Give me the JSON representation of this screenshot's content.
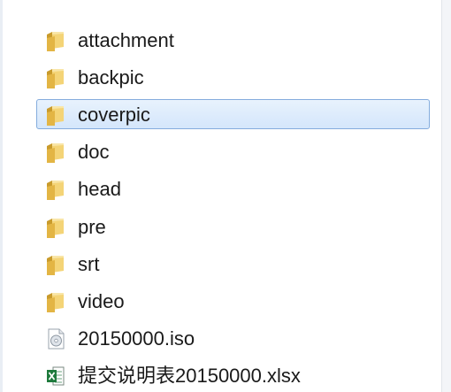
{
  "explorer": {
    "items": [
      {
        "name": "attachment",
        "type": "folder",
        "icon": "folder-icon",
        "selected": false
      },
      {
        "name": "backpic",
        "type": "folder",
        "icon": "folder-icon",
        "selected": false
      },
      {
        "name": "coverpic",
        "type": "folder",
        "icon": "folder-icon",
        "selected": true
      },
      {
        "name": "doc",
        "type": "folder",
        "icon": "folder-icon",
        "selected": false
      },
      {
        "name": "head",
        "type": "folder",
        "icon": "folder-icon",
        "selected": false
      },
      {
        "name": "pre",
        "type": "folder",
        "icon": "folder-icon",
        "selected": false
      },
      {
        "name": "srt",
        "type": "folder",
        "icon": "folder-icon",
        "selected": false
      },
      {
        "name": "video",
        "type": "folder",
        "icon": "folder-icon",
        "selected": false
      },
      {
        "name": "20150000.iso",
        "type": "file",
        "icon": "disc-image-icon",
        "selected": false
      },
      {
        "name": "提交说明表20150000.xlsx",
        "type": "file",
        "icon": "excel-file-icon",
        "selected": false
      }
    ]
  },
  "colors": {
    "folder": "#e8c15a",
    "selection_background": "#d9e9fc",
    "selection_border": "#84acdd",
    "excel": "#1e7a3c"
  }
}
